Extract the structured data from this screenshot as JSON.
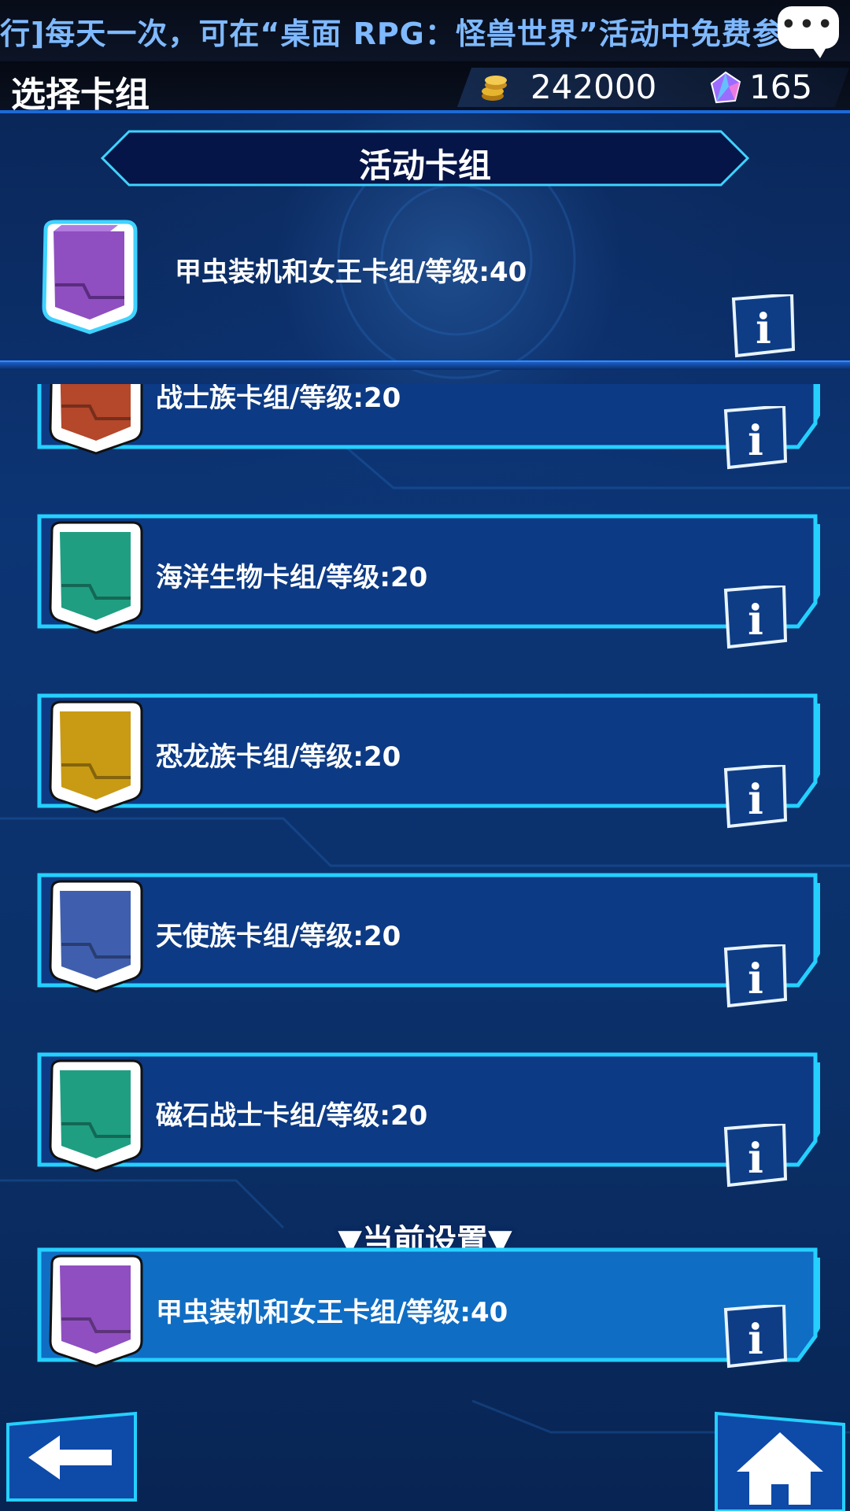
{
  "ticker": {
    "text": "行]每天一次，可在“桌面 RPG：怪兽世界”活动中免费参"
  },
  "header": {
    "title": "选择卡组",
    "gold": "242000",
    "gems": "165"
  },
  "section": {
    "title": "活动卡组"
  },
  "active_deck": {
    "label": "甲虫装机和女王卡组/等级:40",
    "color": "#8f4fc0"
  },
  "decks": [
    {
      "label": "战士族卡组/等级:20",
      "color": "#b5472a"
    },
    {
      "label": "海洋生物卡组/等级:20",
      "color": "#1f9e82"
    },
    {
      "label": "恐龙族卡组/等级:20",
      "color": "#c99a14"
    },
    {
      "label": "天使族卡组/等级:20",
      "color": "#3f5fae"
    },
    {
      "label": "磁石战士卡组/等级:20",
      "color": "#1f9e82"
    }
  ],
  "current": {
    "heading": "▼当前设置▼",
    "label": "甲虫装机和女王卡组/等级:40",
    "color": "#8f4fc0"
  },
  "colors": {
    "accent": "#1ec8ff",
    "panel": "#0c3a84",
    "selected_panel": "#0f6dc4"
  },
  "icons": {
    "back": "arrow-left-icon",
    "home": "home-icon",
    "info": "info-icon",
    "chat": "chat-bubble-icon",
    "coin": "gold-coin-icon",
    "gem": "gem-icon"
  }
}
